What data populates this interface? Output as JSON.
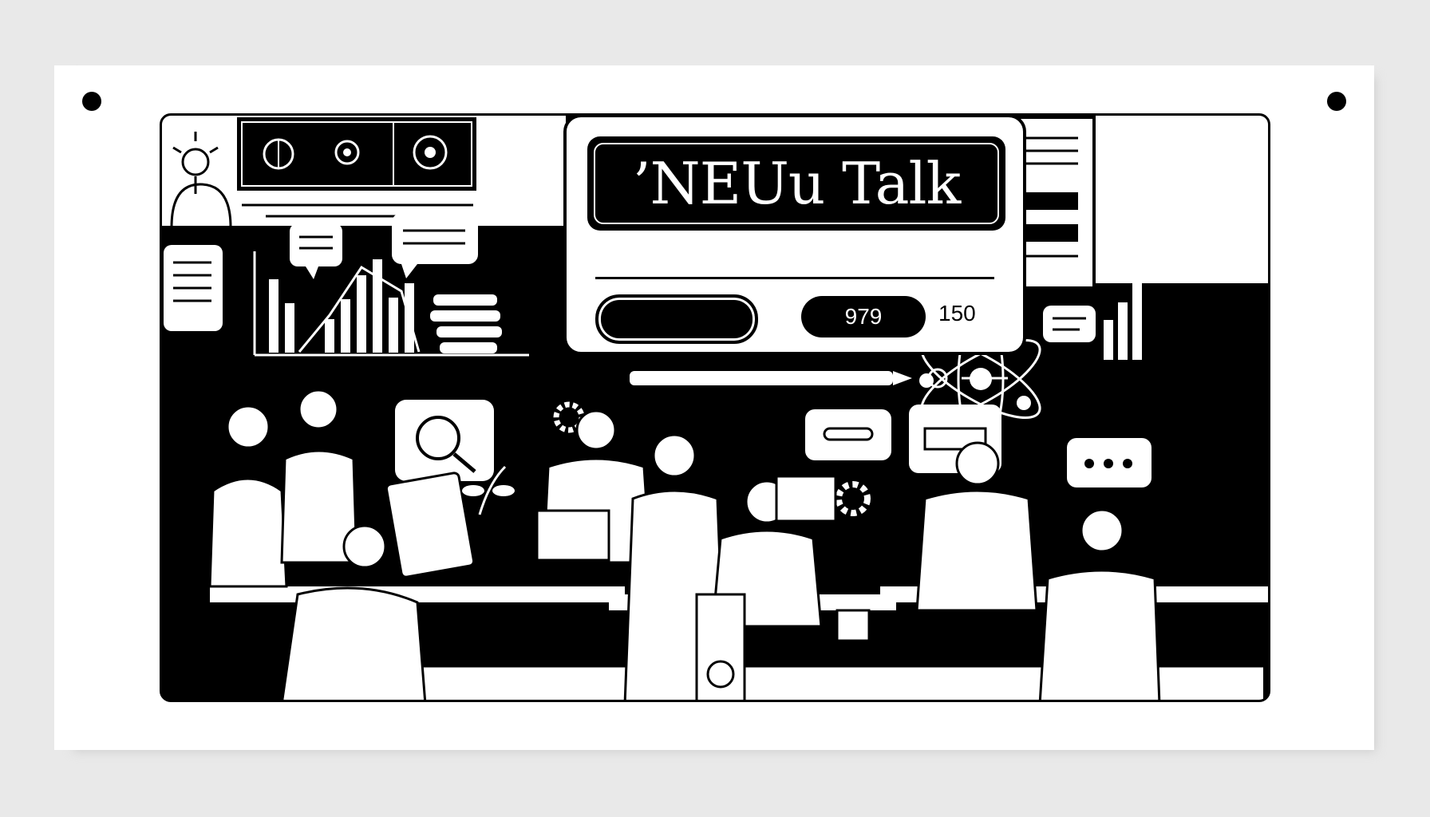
{
  "title": "’NEUu Talk",
  "counter_primary": "979",
  "counter_secondary": "150",
  "colors": {
    "ink": "#000000",
    "paper": "#ffffff",
    "backdrop": "#e9e9e9"
  },
  "icons": [
    "lightbulb-icon",
    "atom-icon",
    "gear-icon",
    "chat-bubble-icon",
    "bar-chart-icon",
    "globe-icon",
    "magnifier-icon",
    "document-icon",
    "pencil-icon"
  ]
}
